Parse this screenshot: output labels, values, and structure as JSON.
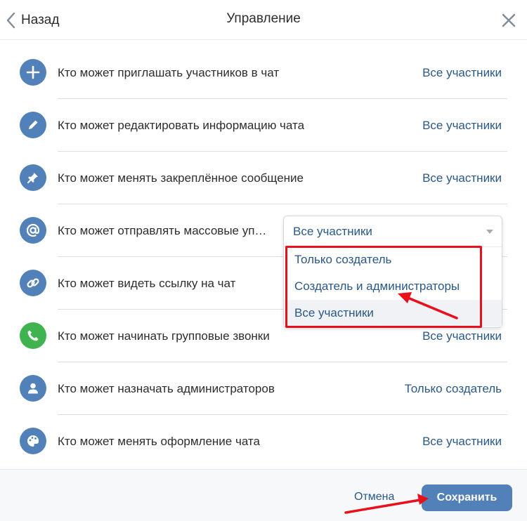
{
  "header": {
    "back_label": "Назад",
    "title": "Управление"
  },
  "rows": [
    {
      "icon": "plus-icon",
      "label": "Кто может приглашать участников в чат",
      "value": "Все участники"
    },
    {
      "icon": "pencil-icon",
      "label": "Кто может редактировать информацию чата",
      "value": "Все участники"
    },
    {
      "icon": "pin-icon",
      "label": "Кто может менять закреплённое сообщение",
      "value": "Все участники"
    },
    {
      "icon": "at-sign-icon",
      "label": "Кто может отправлять массовые уп…",
      "value": "Все участники"
    },
    {
      "icon": "link-icon",
      "label": "Кто может видеть ссылку на чат",
      "value": ""
    },
    {
      "icon": "phone-icon",
      "label": "Кто может начинать групповые звонки",
      "value": "Все участники"
    },
    {
      "icon": "person-icon",
      "label": "Кто может назначать администраторов",
      "value": "Только создатель"
    },
    {
      "icon": "palette-icon",
      "label": "Кто может менять оформление чата",
      "value": "Все участники"
    }
  ],
  "dropdown": {
    "current": "Все участники",
    "options": [
      "Только создатель",
      "Создатель и администраторы",
      "Все участники"
    ]
  },
  "footer": {
    "cancel_label": "Отмена",
    "save_label": "Сохранить"
  },
  "colors": {
    "accent": "#5181b8",
    "link": "#2a5885",
    "annotation": "#e8101b",
    "call_green": "#3fb34f"
  }
}
